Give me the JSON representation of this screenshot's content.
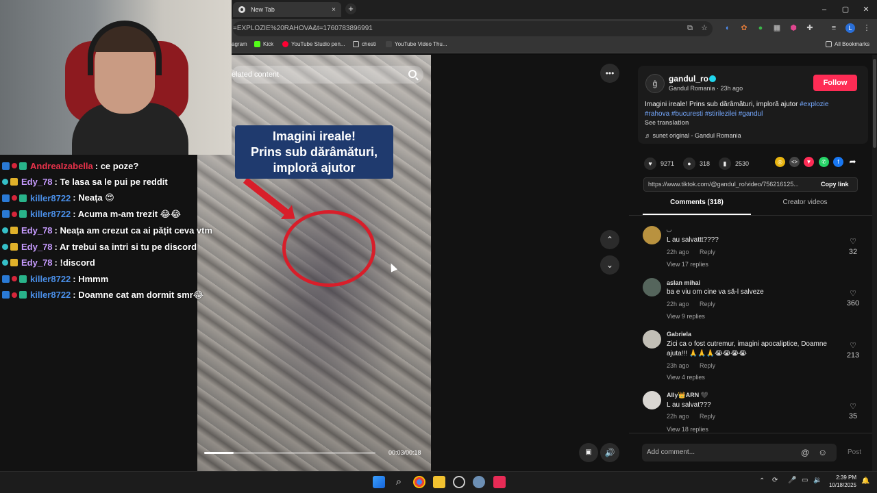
{
  "browser": {
    "tab_title": "New Tab",
    "tab_close": "×",
    "new_tab": "+",
    "url": "=EXPLOZIE%20RAHOVA&t=1760783896991",
    "bookmarks": [
      {
        "label": "agram"
      },
      {
        "label": "Kick"
      },
      {
        "label": "YouTube Studio pen..."
      },
      {
        "label": "chesti"
      },
      {
        "label": "YouTube Video Thu..."
      }
    ],
    "all_bookmarks": "All Bookmarks",
    "window": {
      "minimize": "–",
      "maximize": "▢",
      "close": "✕"
    }
  },
  "video": {
    "search_placeholder": "elated content",
    "caption_lines": [
      "Imagini ireale!",
      "Prins sub dărâmături,",
      "imploră ajutor"
    ],
    "time": "00:03/00:18",
    "progress": 0.17
  },
  "controls": {
    "more": "•••",
    "up": "⌃",
    "down": "⌄"
  },
  "creator": {
    "username": "gandul_ro",
    "subline": "Gandul Romania · 23h ago",
    "follow_label": "Follow",
    "description_text": "Imagini ireale! Prins sub dărâmături, imploră ajutor ",
    "hashtags": [
      "#explozie",
      "#rahova",
      "#bucuresti",
      "#stirilezilei",
      "#gandul"
    ],
    "see_translation": "See translation",
    "sound": "♬  sunet original - Gandul Romania"
  },
  "stats": {
    "likes": "9271",
    "comments": "318",
    "saves": "2530"
  },
  "link": {
    "url": "https://www.tiktok.com/@gandul_ro/video/756216125...",
    "copy_label": "Copy link"
  },
  "tabs": {
    "comments": "Comments (318)",
    "creator_videos": "Creator videos"
  },
  "comments": [
    {
      "user": "◡",
      "text": "L au salvattt????",
      "time": "22h ago",
      "reply": "Reply",
      "views": "View 17 replies",
      "likes": "32",
      "avatar_color": "#b9923f"
    },
    {
      "user": "aslan mihai",
      "text": "ba e viu om cine va să-l salveze",
      "time": "22h ago",
      "reply": "Reply",
      "views": "View 9 replies",
      "likes": "360",
      "avatar_color": "#55655c"
    },
    {
      "user": "Gabriela",
      "text": "Zici ca o fost cutremur, imagini apocaliptice, Doamne ajuta!!! 🙏🙏🙏😭😭😭😭",
      "time": "23h ago",
      "reply": "Reply",
      "views": "View 4 replies",
      "likes": "213",
      "avatar_color": "#c2bfb6"
    },
    {
      "user": "Ally👑ARN 🖤",
      "text": "L au salvat???",
      "time": "22h ago",
      "reply": "Reply",
      "views": "View 18 replies",
      "likes": "35",
      "avatar_color": "#d9d6d2"
    }
  ],
  "comment_box": {
    "placeholder": "Add comment...",
    "post_label": "Post"
  },
  "chat": [
    {
      "user": "AndreaIzabella",
      "color": "#e8324a",
      "msg": ": ce poze?",
      "badges": [
        "sword",
        "dot",
        "green"
      ]
    },
    {
      "user": "Edy_78",
      "color": "#c79bff",
      "msg": ": Te lasa sa le pui pe reddit",
      "badges": [
        "teal",
        "gold"
      ]
    },
    {
      "user": "killer8722",
      "color": "#4a8fe8",
      "msg": ": Neața 😍",
      "badges": [
        "sword",
        "dot",
        "green"
      ]
    },
    {
      "user": "killer8722",
      "color": "#4a8fe8",
      "msg": ": Acuma m-am trezit 😂😂",
      "badges": [
        "sword",
        "dot",
        "green"
      ]
    },
    {
      "user": "Edy_78",
      "color": "#c79bff",
      "msg": ": Neața am crezut ca ai pățit ceva vtm",
      "badges": [
        "teal",
        "gold"
      ]
    },
    {
      "user": "Edy_78",
      "color": "#c79bff",
      "msg": ": Ar trebui sa intri si tu pe discord",
      "badges": [
        "teal",
        "gold"
      ]
    },
    {
      "user": "Edy_78",
      "color": "#c79bff",
      "msg": ": !discord",
      "badges": [
        "teal",
        "gold"
      ]
    },
    {
      "user": "killer8722",
      "color": "#4a8fe8",
      "msg": ": Hmmm",
      "badges": [
        "sword",
        "dot",
        "green"
      ]
    },
    {
      "user": "killer8722",
      "color": "#4a8fe8",
      "msg": ": Doamne cat am dormit smr😂",
      "badges": [
        "sword",
        "dot",
        "green"
      ]
    }
  ],
  "taskbar": {
    "time": "2:39 PM",
    "date": "10/18/2025"
  }
}
